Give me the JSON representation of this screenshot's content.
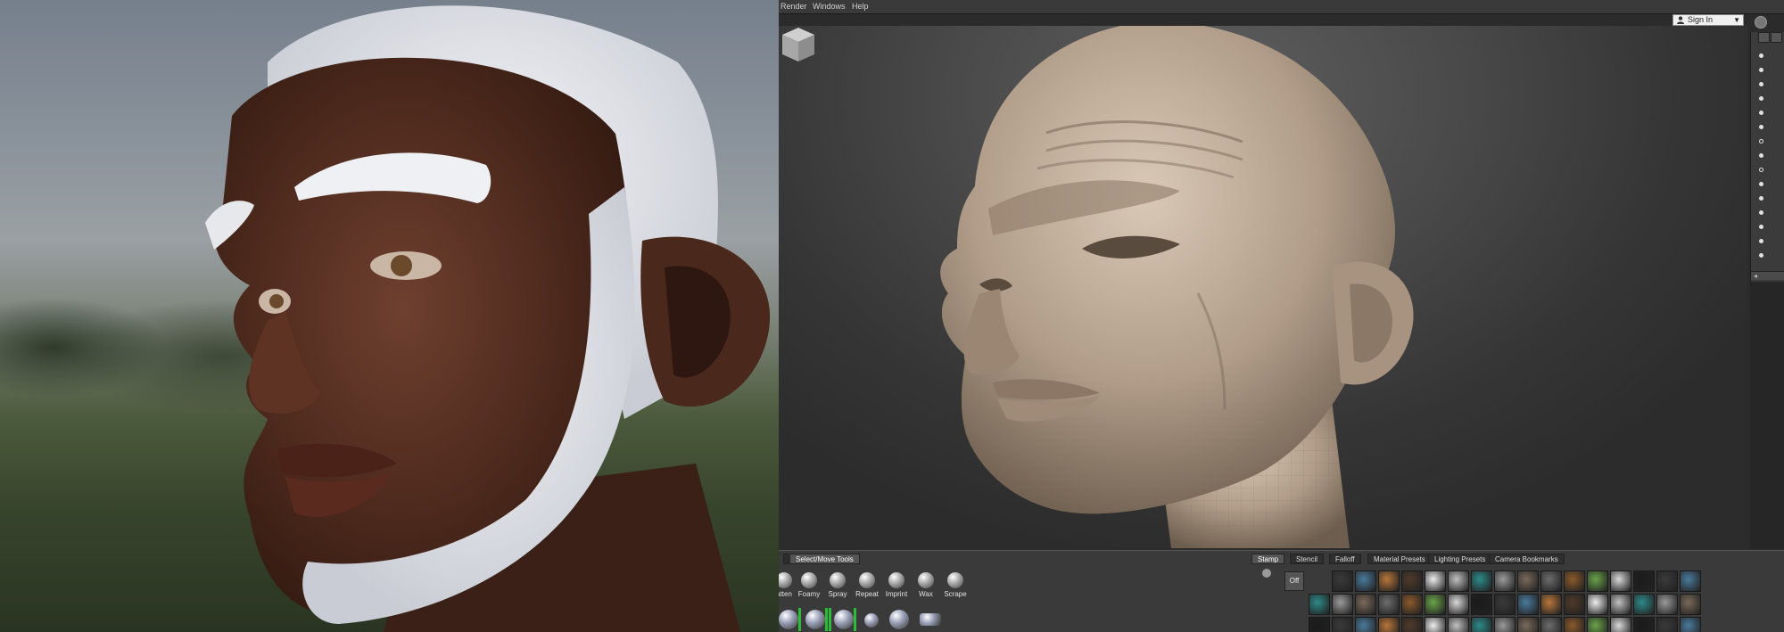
{
  "menubar": {
    "items": [
      "Render",
      "Windows",
      "Help"
    ]
  },
  "account": {
    "signin_label": "Sign In"
  },
  "tray": {
    "left_tabs": [
      "Select/Move Tools"
    ],
    "tools": [
      "atten",
      "Foamy",
      "Spray",
      "Repeat",
      "Imprint",
      "Wax",
      "Scrape"
    ],
    "right_tabs": [
      "Stamp",
      "Stencil",
      "Falloff",
      "Material Presets",
      "Lighting Presets",
      "Camera Bookmarks"
    ],
    "active_right_tab": "Stamp",
    "off_label": "Off"
  },
  "icons": {
    "user": "user-icon",
    "dropdown": "chevron-down-icon",
    "nav_cube": "view-cube-icon",
    "scroll_left": "chevron-left-icon"
  },
  "colors": {
    "skin_render": "#5a3426",
    "beard": "#e8e8e8",
    "clay": "#b4a391",
    "tool_selected_bracket": "#2dbb3a"
  }
}
